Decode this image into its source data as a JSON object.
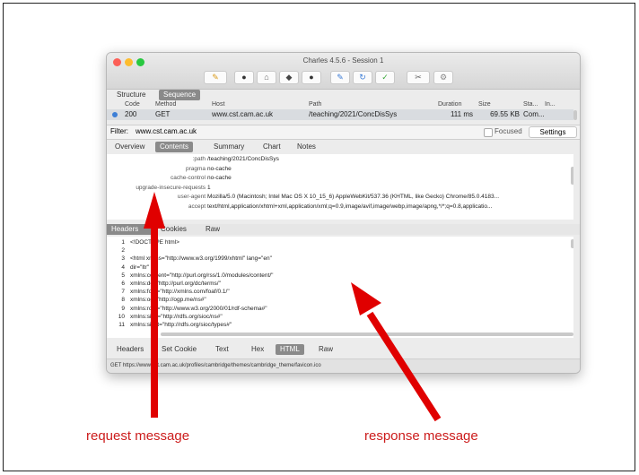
{
  "window": {
    "title": "Charles 4.5.6 - Session 1"
  },
  "toolbar": [
    {
      "name": "broom-icon",
      "glyph": "✎",
      "color": "#d99a1a"
    },
    {
      "name": "record-icon",
      "glyph": "●",
      "color": "#333333"
    },
    {
      "name": "throttle-icon",
      "glyph": "⌂",
      "color": "#666666"
    },
    {
      "name": "turtle-icon",
      "glyph": "◆",
      "color": "#444444"
    },
    {
      "name": "breakpoint-icon",
      "glyph": "●",
      "color": "#333333"
    },
    {
      "name": "compose-icon",
      "glyph": "✎",
      "color": "#3a7bd5"
    },
    {
      "name": "refresh-icon",
      "glyph": "↻",
      "color": "#3a7bd5"
    },
    {
      "name": "validate-icon",
      "glyph": "✓",
      "color": "#3aa83a"
    },
    {
      "name": "tools-icon",
      "glyph": "✂",
      "color": "#666666"
    },
    {
      "name": "settings-icon",
      "glyph": "⚙",
      "color": "#888888"
    }
  ],
  "view_tabs": [
    "Structure",
    "Sequence"
  ],
  "table": {
    "headers": [
      "Code",
      "Method",
      "Host",
      "Path",
      "Duration",
      "Size",
      "Sta...",
      "In..."
    ],
    "row": {
      "code": "200",
      "method": "GET",
      "host": "www.cst.cam.ac.uk",
      "path": "/teaching/2021/ConcDisSys",
      "duration": "111 ms",
      "size": "69.55 KB",
      "status": "Com..."
    }
  },
  "filter": {
    "label": "Filter:",
    "value": "www.cst.cam.ac.uk",
    "focused_label": "Focused",
    "settings_label": "Settings"
  },
  "request_tabs": [
    "Overview",
    "Contents",
    "Summary",
    "Chart",
    "Notes"
  ],
  "request_headers": [
    {
      "k": ":path",
      "v": "/teaching/2021/ConcDisSys"
    },
    {
      "k": "pragma",
      "v": "no-cache"
    },
    {
      "k": "cache-control",
      "v": "no-cache"
    },
    {
      "k": "upgrade-insecure-requests",
      "v": "1"
    },
    {
      "k": "user-agent",
      "v": "Mozilla/5.0 (Macintosh; Intel Mac OS X 10_15_6) AppleWebKit/537.36 (KHTML, like Gecko) Chrome/85.0.4183..."
    },
    {
      "k": "accept",
      "v": "text/html,application/xhtml+xml,application/xml;q=0.9,image/avif,image/webp,image/apng,*/*;q=0.8,applicatio..."
    }
  ],
  "mid_tabs": [
    "Headers",
    "Cookies",
    "Raw"
  ],
  "html_lines": [
    {
      "n": "1",
      "t": "<!DOCTYPE html>"
    },
    {
      "n": "2",
      "t": ""
    },
    {
      "n": "3",
      "t": "<html xmlns=\"http://www.w3.org/1999/xhtml\" lang=\"en\""
    },
    {
      "n": "4",
      "t": "   dir=\"ltr\""
    },
    {
      "n": "5",
      "t": "  xmlns:content=\"http://purl.org/rss/1.0/modules/content/\""
    },
    {
      "n": "6",
      "t": "  xmlns:dc=\"http://purl.org/dc/terms/\""
    },
    {
      "n": "7",
      "t": "  xmlns:foaf=\"http://xmlns.com/foaf/0.1/\""
    },
    {
      "n": "8",
      "t": "  xmlns:og=\"http://ogp.me/ns#\""
    },
    {
      "n": "9",
      "t": "  xmlns:rdfs=\"http://www.w3.org/2000/01/rdf-schema#\""
    },
    {
      "n": "10",
      "t": "  xmlns:sioc=\"http://rdfs.org/sioc/ns#\""
    },
    {
      "n": "11",
      "t": "  xmlns:sioct=\"http://rdfs.org/sioc/types#\""
    }
  ],
  "bottom_tabs": [
    "Headers",
    "Set Cookie",
    "Text",
    "Hex",
    "HTML",
    "Raw"
  ],
  "status": "GET https://www.cst.cam.ac.uk/profiles/cambridge/themes/cambridge_theme/favicon.ico",
  "annotations": {
    "left": "request message",
    "right": "response message",
    "color": "#e00000"
  }
}
